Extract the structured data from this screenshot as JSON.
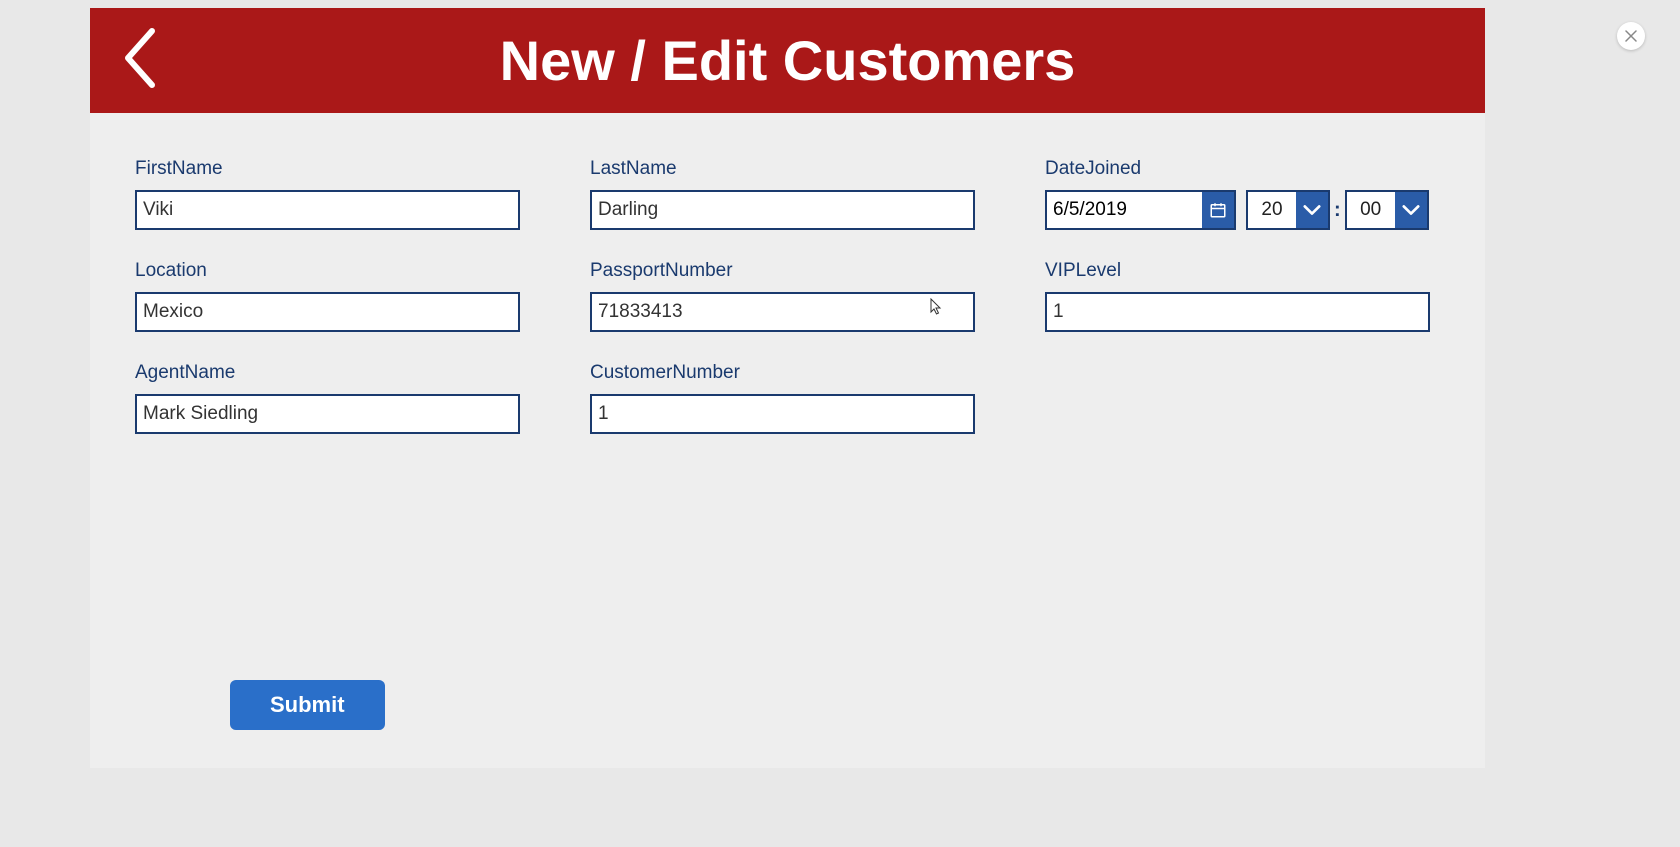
{
  "header": {
    "title": "New / Edit Customers"
  },
  "fields": {
    "firstName": {
      "label": "FirstName",
      "value": "Viki"
    },
    "lastName": {
      "label": "LastName",
      "value": "Darling"
    },
    "dateJoined": {
      "label": "DateJoined",
      "date": "6/5/2019",
      "hour": "20",
      "minute": "00",
      "separator": ":"
    },
    "location": {
      "label": "Location",
      "value": "Mexico"
    },
    "passportNumber": {
      "label": "PassportNumber",
      "value": "71833413"
    },
    "vipLevel": {
      "label": "VIPLevel",
      "value": "1"
    },
    "agentName": {
      "label": "AgentName",
      "value": "Mark Siedling"
    },
    "customerNumber": {
      "label": "CustomerNumber",
      "value": "1"
    }
  },
  "actions": {
    "submit_label": "Submit"
  },
  "colors": {
    "headerBg": "#aa1818",
    "accentBlue": "#2a5ca8",
    "borderBlue": "#1a3a6e",
    "submitBlue": "#2a6fc9"
  }
}
